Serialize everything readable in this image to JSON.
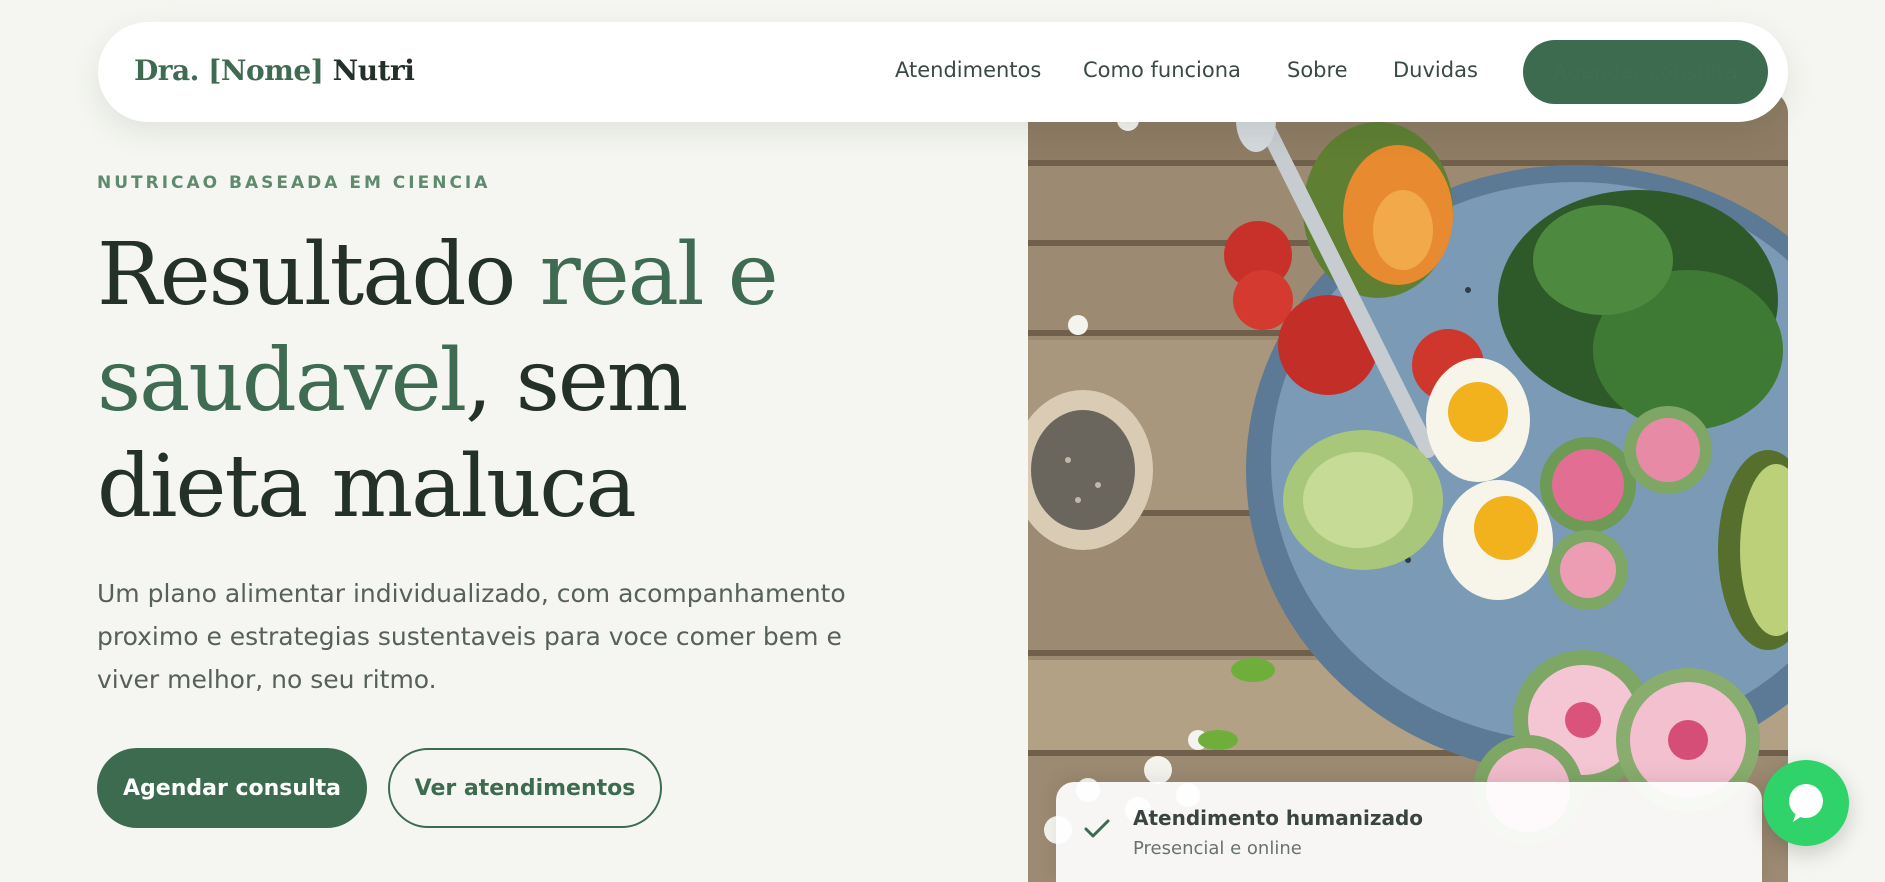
{
  "nav": {
    "brand_accent": "Dra. [Nome]",
    "brand_main": "Nutri",
    "links": [
      "Atendimentos",
      "Como funciona",
      "Sobre",
      "Duvidas"
    ],
    "cta_label": "Agendar consulta"
  },
  "hero": {
    "eyebrow": "NUTRICAO BASEADA EM CIENCIA",
    "headline_part1": "Resultado ",
    "headline_accent": "real e saudavel",
    "headline_part2": ", sem dieta maluca",
    "lead": "Um plano alimentar individualizado, com acompanhamento proximo e estrategias sustentaveis para voce comer bem e viver melhor, no seu ritmo.",
    "primary_button": "Agendar consulta",
    "secondary_button": "Ver atendimentos",
    "image_icon": "salad-bowl-photo"
  },
  "card": {
    "icon": "check-icon",
    "title": "Atendimento humanizado",
    "subtitle": "Presencial e online"
  },
  "chat": {
    "icon": "whatsapp-chat-icon"
  },
  "colors": {
    "brand_green": "#3d6b50",
    "accent_text": "#3f6b52",
    "background": "#f5f6f1",
    "whatsapp": "#2fd36a"
  }
}
